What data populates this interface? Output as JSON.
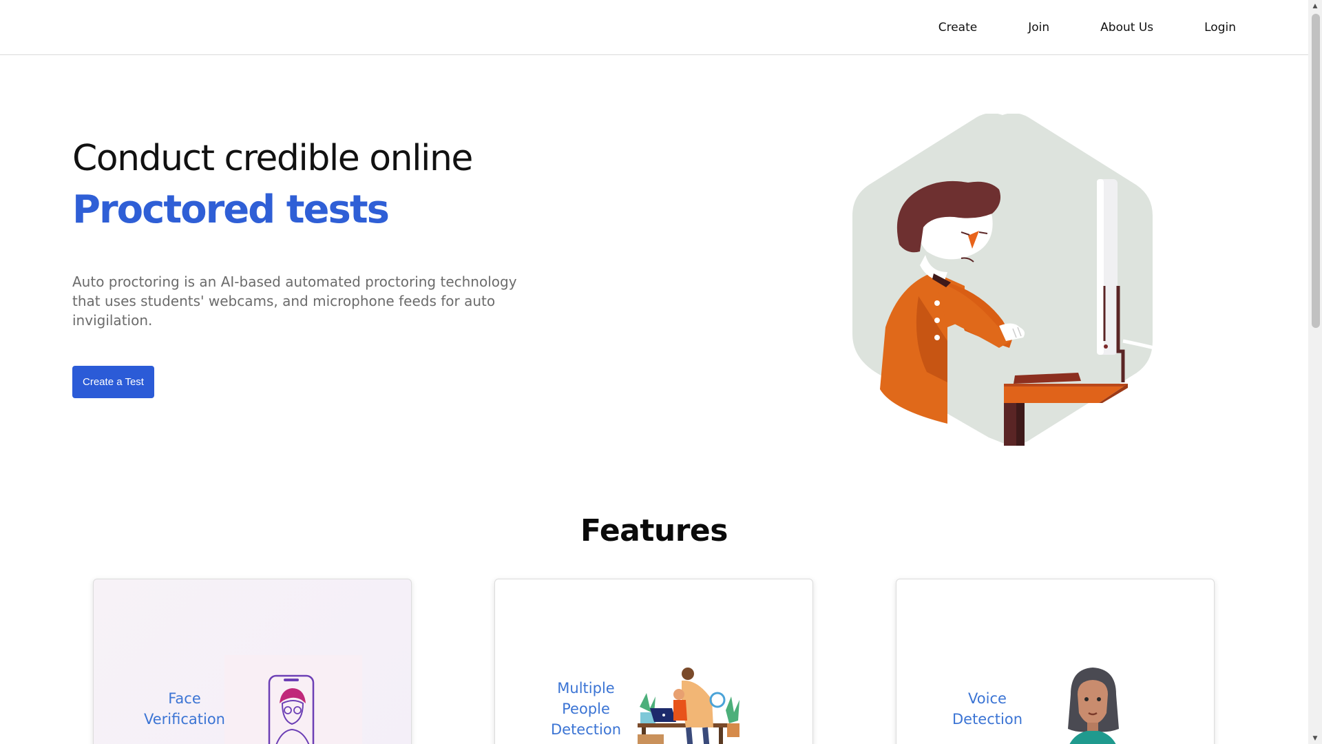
{
  "nav": {
    "links": [
      "Create",
      "Join",
      "About Us",
      "Login"
    ]
  },
  "hero": {
    "title": "Conduct credible online",
    "accent": "Proctored tests",
    "description": "Auto proctoring is an AI-based automated proctoring technology that uses students' webcams, and microphone feeds for auto invigilation.",
    "cta_label": "Create a Test"
  },
  "features": {
    "title": "Features",
    "cards": [
      {
        "label_line1": "Face",
        "label_line2": "Verification"
      },
      {
        "label_line1": "Multiple",
        "label_line2": "People",
        "label_line3": "Detection"
      },
      {
        "label_line1": "Voice",
        "label_line2": "Detection"
      }
    ]
  },
  "colors": {
    "accent": "#2f5fd6",
    "button": "#2b5bd7",
    "card_label": "#3b74d4"
  }
}
